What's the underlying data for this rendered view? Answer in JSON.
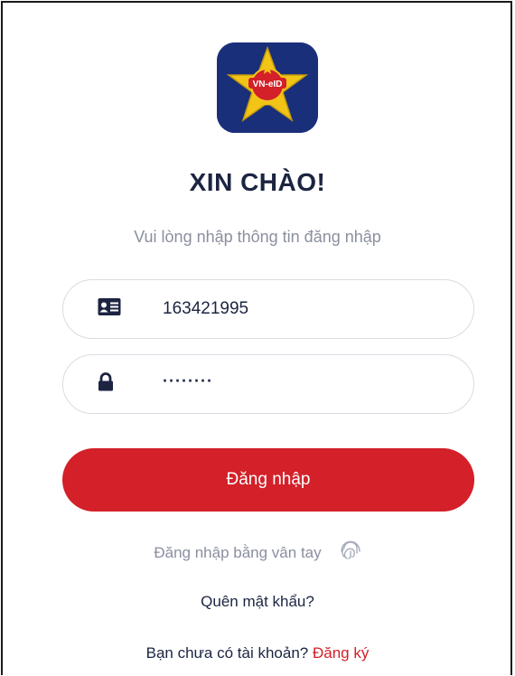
{
  "app": {
    "logo_text": "VN-eID",
    "logo_icon": "star-shield-logo"
  },
  "header": {
    "title": "XIN CHÀO!",
    "subtitle": "Vui lòng nhập thông tin đăng nhập"
  },
  "form": {
    "id_field": {
      "icon": "id-card-icon",
      "value": "163421995"
    },
    "password_field": {
      "icon": "lock-icon",
      "value": "········"
    },
    "login_label": "Đăng nhập"
  },
  "fingerprint": {
    "label": "Đăng nhập bằng vân tay",
    "icon": "fingerprint-icon"
  },
  "forgot_label": "Quên mật khẩu?",
  "register": {
    "prompt": "Bạn chưa có tài khoản?",
    "link_label": "Đăng ký"
  },
  "colors": {
    "accent": "#d32029",
    "title": "#1c2442",
    "muted": "#8a8fa0",
    "logo_bg": "#1a2f7a"
  }
}
